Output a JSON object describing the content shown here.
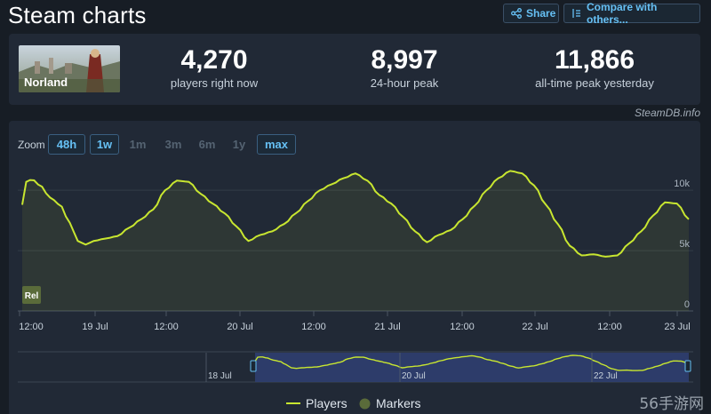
{
  "header": {
    "title": "Steam charts",
    "share_label": "Share",
    "compare_label": "Compare with others..."
  },
  "game": {
    "logo_text": "Norland"
  },
  "stats": [
    {
      "value": "4,270",
      "label": "players right now"
    },
    {
      "value": "8,997",
      "label": "24-hour peak"
    },
    {
      "value": "11,866",
      "label": "all-time peak yesterday"
    }
  ],
  "attribution": "SteamDB.info",
  "zoom": {
    "label": "Zoom",
    "options": [
      {
        "label": "48h",
        "active": true
      },
      {
        "label": "1w",
        "active": true
      },
      {
        "label": "1m",
        "active": false
      },
      {
        "label": "3m",
        "active": false
      },
      {
        "label": "6m",
        "active": false
      },
      {
        "label": "1y",
        "active": false
      },
      {
        "label": "max",
        "active": true
      }
    ]
  },
  "marker_label": "Rel",
  "navigator_labels": [
    "18 Jul",
    "20 Jul",
    "22 Jul"
  ],
  "legend": {
    "players": "Players",
    "markers": "Markers"
  },
  "site_watermark": "56手游网",
  "colors": {
    "line": "#c8e630",
    "accent": "#66c0f4",
    "marker": "#5a6b3a"
  },
  "chart_data": {
    "type": "area",
    "series": [
      {
        "name": "Players",
        "x": [
          0,
          0.3,
          0.6,
          1.3,
          2,
          2.5,
          3,
          3.5,
          4,
          4.5,
          5,
          5.5,
          6,
          6.5,
          7,
          7.5,
          8,
          8.3,
          8.6,
          9,
          9.5,
          10,
          10.5,
          11,
          11.5,
          12,
          12.5,
          13,
          13.5,
          14,
          14.5,
          15,
          15.5,
          16,
          16.5,
          17,
          17.5,
          18,
          18.5,
          19,
          19.5,
          20,
          20.5,
          21,
          21.5,
          22,
          22.5,
          23,
          23.5,
          24,
          24.5,
          25,
          25.5,
          26,
          26.5,
          27,
          27.5,
          28,
          28.5,
          29,
          29.5,
          30,
          30.5,
          31,
          31.5,
          32,
          32.5,
          33,
          33.5,
          34,
          34.5,
          35,
          35.5,
          36,
          36.5,
          37,
          37.5,
          38,
          38.5,
          39,
          39.5,
          40,
          40.5,
          41,
          41.5,
          42,
          42.5,
          43,
          43.5,
          44,
          44.5,
          45,
          45.5,
          46,
          46.5,
          47,
          47.5,
          48,
          48.5,
          49,
          49.5,
          50,
          50.5,
          51,
          51.5,
          52,
          52.5,
          53,
          53.5,
          54,
          54.5,
          55,
          55.5,
          56,
          56.5,
          57,
          57.5,
          58,
          58.5,
          59,
          59.5,
          60,
          60.5,
          61,
          61.5,
          62,
          62.5,
          63,
          63.5,
          64,
          64.5,
          65,
          65.5,
          66,
          66.5,
          67,
          67.5,
          68,
          68.5,
          69,
          69.5,
          70,
          70.5,
          71,
          71.5,
          72,
          72.5,
          73,
          73.5,
          74,
          74.5,
          75,
          75.5,
          76,
          76.5,
          77,
          77.5,
          78,
          78.5,
          79,
          79.5,
          80,
          80.5,
          81,
          81.5,
          82,
          82.5,
          83,
          83.5,
          84,
          84.5,
          85,
          85.5,
          86,
          86.5,
          87,
          87.5,
          88,
          88.5,
          89,
          89.5,
          90,
          90.5,
          91,
          91.5,
          92,
          92.5,
          93,
          93.5,
          94,
          94.5,
          95,
          95.5,
          96,
          96.5,
          97,
          97.5,
          98,
          98.5,
          99,
          99.5,
          100,
          100.5,
          101,
          101.5,
          102,
          102.5,
          103,
          103.5,
          104,
          104.5,
          105,
          105.5,
          106,
          106.5,
          107,
          107.5,
          108,
          108.5,
          109,
          109.5,
          110,
          110.5,
          111,
          111.5,
          112,
          112.5,
          113,
          113.5,
          114,
          114.5,
          115,
          115.5,
          116,
          116.5,
          117,
          117.5,
          118,
          118.5,
          119,
          119.5,
          120,
          120.5,
          121,
          121.5,
          122,
          122.5,
          123,
          123.5,
          124,
          124.5,
          125,
          125.5,
          126,
          126.5,
          127,
          127.5,
          128,
          128.5,
          129,
          129.5,
          130,
          130.5,
          131,
          131.5,
          132,
          132.5,
          133,
          133.5,
          134,
          134.5,
          135,
          135.5,
          136,
          136.5,
          137,
          137.5,
          138,
          138.5,
          139,
          139.5,
          140,
          140.5,
          141,
          141.5,
          142,
          142.5,
          143,
          143.5,
          144,
          144.5,
          145,
          145.5,
          146,
          146.5,
          147,
          147.5,
          148,
          148.5,
          149,
          149.5,
          150,
          150.5,
          151,
          151.5,
          152,
          152.5,
          153,
          153.5,
          154,
          154.5,
          155,
          155.5,
          156,
          156.5,
          157,
          157.5,
          158,
          158.5,
          159,
          159.5,
          160,
          160.5,
          161,
          161.5,
          162,
          162.5,
          163,
          163.5,
          164,
          164.5,
          165,
          165.5,
          166,
          166.5,
          167,
          167.5,
          168
        ],
        "y_keypoints": [
          [
            0,
            8800
          ],
          [
            1,
            10700
          ],
          [
            2.5,
            10900
          ],
          [
            4.5,
            10400
          ],
          [
            7,
            9400
          ],
          [
            9.5,
            8800
          ],
          [
            12,
            7300
          ],
          [
            14,
            5800
          ],
          [
            16,
            5500
          ],
          [
            18,
            5800
          ],
          [
            21,
            6000
          ],
          [
            24,
            6200
          ],
          [
            27,
            6900
          ],
          [
            30,
            7600
          ],
          [
            33,
            8400
          ],
          [
            36,
            10000
          ],
          [
            39,
            10800
          ],
          [
            42,
            10700
          ],
          [
            45,
            9700
          ],
          [
            48,
            8900
          ],
          [
            51,
            8100
          ],
          [
            54,
            7000
          ],
          [
            57,
            5800
          ],
          [
            60,
            6300
          ],
          [
            63,
            6600
          ],
          [
            66,
            7200
          ],
          [
            69,
            8100
          ],
          [
            72,
            9100
          ],
          [
            75,
            10000
          ],
          [
            78,
            10500
          ],
          [
            81,
            11000
          ],
          [
            84,
            11400
          ],
          [
            87,
            10800
          ],
          [
            90,
            9600
          ],
          [
            93,
            8900
          ],
          [
            96,
            7800
          ],
          [
            99,
            6600
          ],
          [
            102,
            5700
          ],
          [
            105,
            6300
          ],
          [
            108,
            6700
          ],
          [
            111,
            7600
          ],
          [
            114,
            8700
          ],
          [
            117,
            10000
          ],
          [
            120,
            11000
          ],
          [
            123,
            11600
          ],
          [
            126,
            11400
          ],
          [
            129,
            10400
          ],
          [
            132,
            8800
          ],
          [
            135,
            7200
          ],
          [
            138,
            5400
          ],
          [
            141,
            4600
          ],
          [
            144,
            4700
          ],
          [
            147,
            4500
          ],
          [
            150,
            4600
          ],
          [
            153,
            5600
          ],
          [
            156,
            6600
          ],
          [
            159,
            7900
          ],
          [
            162,
            9000
          ],
          [
            165,
            8900
          ],
          [
            168,
            7600
          ]
        ]
      }
    ],
    "x_tick_labels": [
      "12:00",
      "19 Jul",
      "12:00",
      "20 Jul",
      "12:00",
      "21 Jul",
      "12:00",
      "22 Jul",
      "12:00",
      "23 Jul"
    ],
    "y_tick_labels": [
      "0",
      "5k",
      "10k"
    ],
    "ylim": [
      0,
      12000
    ],
    "grid": true,
    "legend": "bottom"
  }
}
